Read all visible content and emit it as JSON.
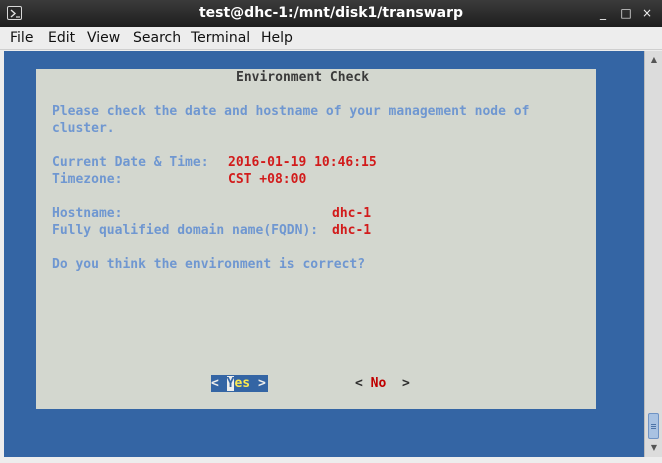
{
  "window": {
    "title": "test@dhc-1:/mnt/disk1/transwarp",
    "controls": {
      "minimize": "_",
      "maximize": "□",
      "close": "×"
    }
  },
  "menubar": {
    "items": [
      "File",
      "Edit",
      "View",
      "Search",
      "Terminal",
      "Help"
    ]
  },
  "dialog": {
    "title": "Environment Check",
    "intro_line1": "Please check the date and hostname of your management node of",
    "intro_line2": "cluster.",
    "datetime_label": "Current Date & Time:",
    "datetime_value": "2016-01-19 10:46:15",
    "timezone_label": "Timezone:",
    "timezone_value": "CST +08:00",
    "hostname_label": "Hostname:",
    "hostname_value": "dhc-1",
    "fqdn_label": "Fully qualified domain name(FQDN):",
    "fqdn_value": "dhc-1",
    "question": "Do you think the environment is correct?",
    "yes_button": {
      "left": "< ",
      "key": "Y",
      "rest": "es",
      "right": " >"
    },
    "no_button": {
      "left": "< ",
      "key": "N",
      "rest": "o",
      "right": "  >"
    }
  },
  "colors": {
    "terminal_background": "#3465a4",
    "dialog_background": "#d3d7cf",
    "label_text": "#6f97d1",
    "value_text": "#d21b1b"
  }
}
